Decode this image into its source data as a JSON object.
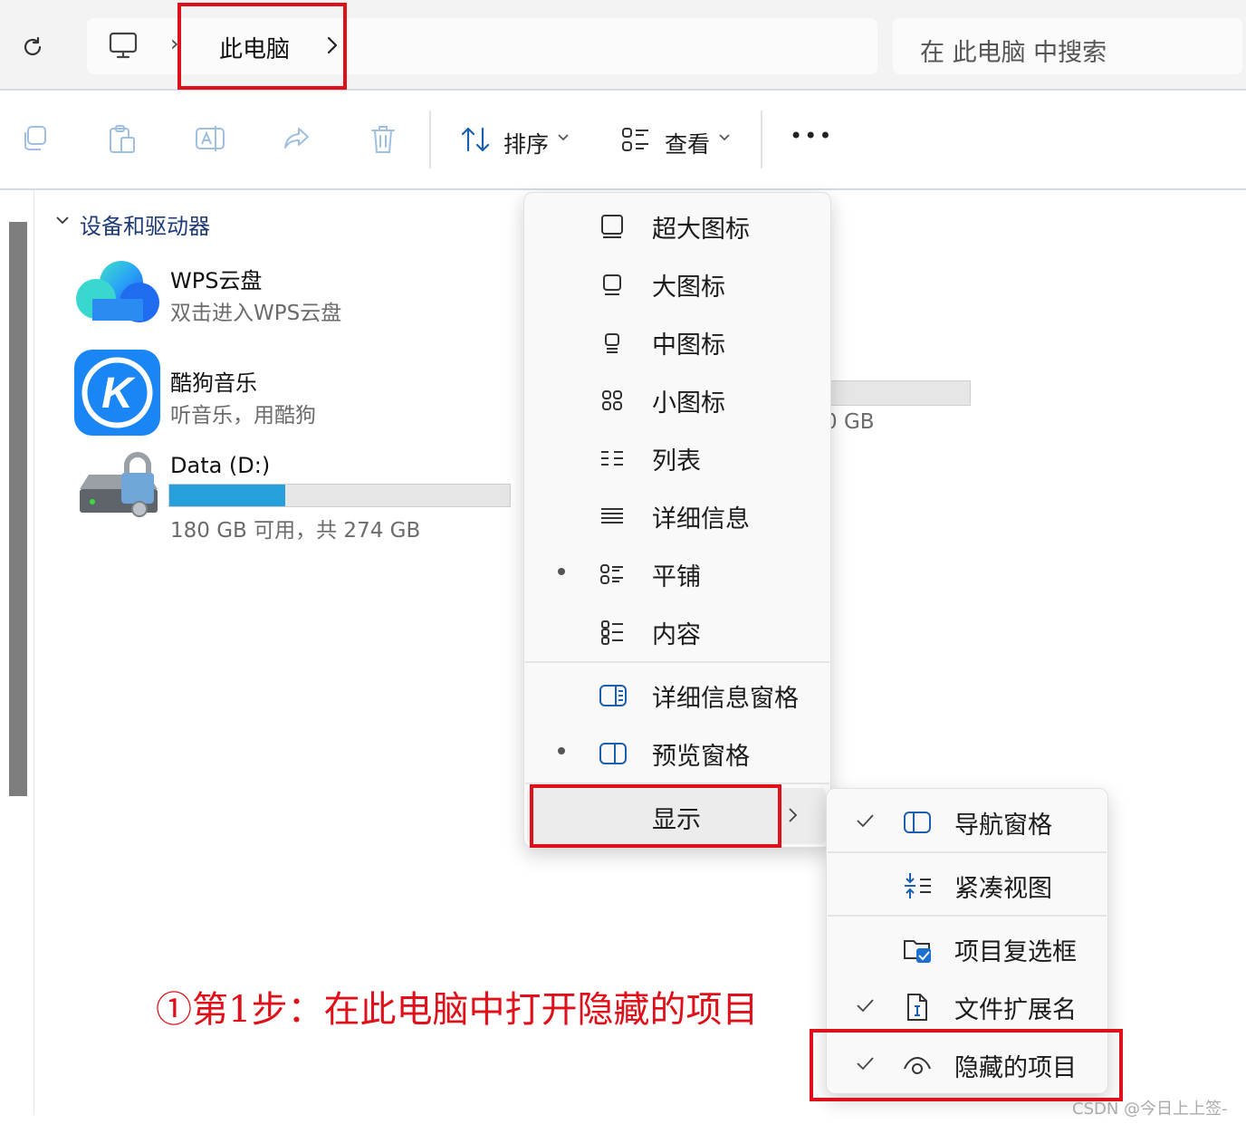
{
  "address": {
    "breadcrumb": "此电脑",
    "search_placeholder": "在 此电脑 中搜索"
  },
  "toolbar": {
    "icons": [
      "copy-icon",
      "paste-icon",
      "rename-icon",
      "share-icon",
      "delete-icon"
    ],
    "sort_label": "排序",
    "view_label": "查看",
    "more_label": "•••"
  },
  "content": {
    "group_header": "设备和驱动器",
    "items": [
      {
        "title": "WPS云盘",
        "subtitle": "双击进入WPS云盘",
        "icon": "wps-cloud-icon"
      },
      {
        "title": "酷狗音乐",
        "subtitle": "听音乐，用酷狗",
        "icon": "kugou-icon"
      },
      {
        "title": "Data (D:)",
        "subtitle": "180 GB 可用，共 274 GB",
        "icon": "drive-icon",
        "used_fraction": 0.34
      }
    ],
    "partial_drive_text": "0 GB",
    "partial_drive_used_fraction": 0.0
  },
  "view_menu": {
    "items": [
      {
        "label": "超大图标",
        "icon": "extra-large-icons-icon",
        "selected": false
      },
      {
        "label": "大图标",
        "icon": "large-icons-icon",
        "selected": false
      },
      {
        "label": "中图标",
        "icon": "medium-icons-icon",
        "selected": false
      },
      {
        "label": "小图标",
        "icon": "small-icons-icon",
        "selected": false
      },
      {
        "label": "列表",
        "icon": "list-icon",
        "selected": false
      },
      {
        "label": "详细信息",
        "icon": "details-icon",
        "selected": false
      },
      {
        "label": "平铺",
        "icon": "tiles-icon",
        "selected": true
      },
      {
        "label": "内容",
        "icon": "content-icon",
        "selected": false
      }
    ],
    "panes": [
      {
        "label": "详细信息窗格",
        "icon": "details-pane-icon",
        "selected": false
      },
      {
        "label": "预览窗格",
        "icon": "preview-pane-icon",
        "selected": true
      }
    ],
    "show_label": "显示"
  },
  "show_submenu": {
    "items": [
      {
        "label": "导航窗格",
        "icon": "navigation-pane-icon",
        "checked": true
      },
      {
        "label": "紧凑视图",
        "icon": "compact-view-icon",
        "checked": false
      },
      {
        "label": "项目复选框",
        "icon": "item-checkbox-icon",
        "checked": false
      },
      {
        "label": "文件扩展名",
        "icon": "file-extension-icon",
        "checked": true
      },
      {
        "label": "隐藏的项目",
        "icon": "eye-icon",
        "checked": true
      }
    ]
  },
  "annotation": {
    "caption": "①第1步：在此电脑中打开隐藏的项目",
    "watermark": "CSDN @今日上上签-"
  },
  "colors": {
    "highlight_box": "#e0101a",
    "drive_bar_fill": "#26a0da",
    "annotation_text": "#e0101a",
    "group_header": "#1f3b76"
  }
}
